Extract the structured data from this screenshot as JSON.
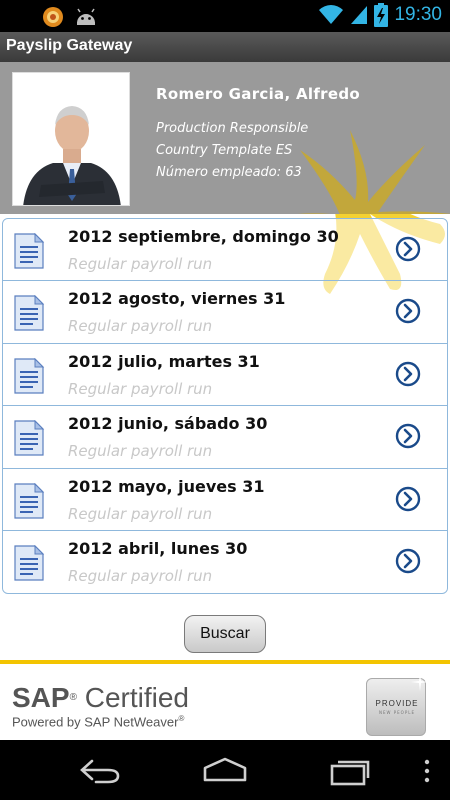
{
  "status_bar": {
    "time": "19:30",
    "icons": [
      "notification-icon",
      "android-icon",
      "wifi-icon",
      "signal-icon",
      "battery-icon"
    ]
  },
  "app": {
    "title": "Payslip Gateway"
  },
  "profile": {
    "name": "Romero Garcia, Alfredo",
    "position": "Production Responsible",
    "country_template": "Country Template ES",
    "employee_number": "Número empleado: 63"
  },
  "payslips": [
    {
      "date": "2012 septiembre, domingo 30",
      "type": "Regular payroll run"
    },
    {
      "date": "2012 agosto, viernes 31",
      "type": "Regular payroll run"
    },
    {
      "date": "2012 julio, martes 31",
      "type": "Regular payroll run"
    },
    {
      "date": "2012 junio, sábado 30",
      "type": "Regular payroll run"
    },
    {
      "date": "2012 mayo, jueves 31",
      "type": "Regular payroll run"
    },
    {
      "date": "2012 abril, lunes 30",
      "type": "Regular payroll run"
    }
  ],
  "search_button": {
    "label": "Buscar"
  },
  "footer": {
    "sap_brand": "SAP",
    "sap_certified": "Certified",
    "powered_by": "Powered by SAP NetWeaver",
    "partner_logo": "PROVIDE",
    "partner_tagline": "NEW PEOPLE"
  },
  "colors": {
    "accent_blue": "#33b5e5",
    "list_border": "#8fb8dc",
    "chevron_blue": "#1a4a8a",
    "brand_yellow": "#f3c400"
  }
}
